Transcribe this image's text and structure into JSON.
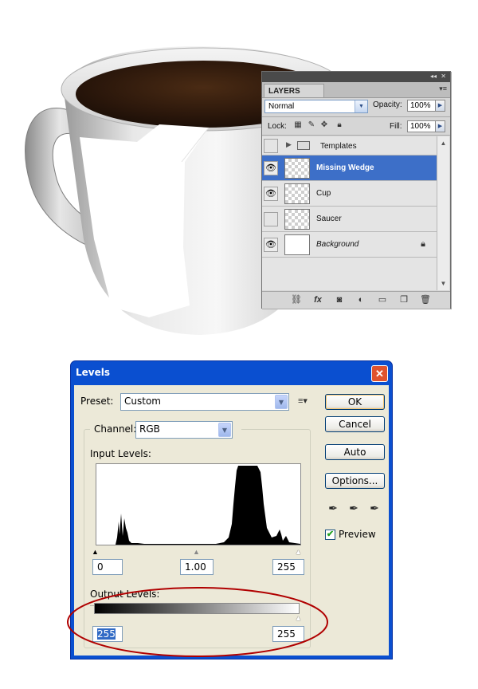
{
  "layers_panel": {
    "tab_label": "LAYERS",
    "collapse_glyph": "◂◂",
    "close_glyph": "✕",
    "menu_glyph": "▾≡",
    "blend_mode": "Normal",
    "opacity_label": "Opacity:",
    "opacity_value": "100%",
    "lock_label": "Lock:",
    "fill_label": "Fill:",
    "fill_value": "100%",
    "group_row": {
      "name": "Templates"
    },
    "layers": [
      {
        "name": "Missing Wedge",
        "visible": true,
        "selected": true
      },
      {
        "name": "Cup",
        "visible": true,
        "selected": false
      },
      {
        "name": "Saucer",
        "visible": false,
        "selected": false
      },
      {
        "name": "Background",
        "visible": true,
        "selected": false,
        "locked": true
      }
    ],
    "footer_icons": [
      "link-icon",
      "fx-icon",
      "mask-icon",
      "adjustment-icon",
      "group-folder-icon",
      "new-layer-icon",
      "trash-icon"
    ]
  },
  "levels_dialog": {
    "title": "Levels",
    "close_glyph": "✕",
    "preset_label": "Preset:",
    "preset_value": "Custom",
    "preset_menu_glyph": "≡▾",
    "channel_label": "Channel:",
    "channel_value": "RGB",
    "input_levels_label": "Input Levels:",
    "input_black": "0",
    "input_gamma": "1.00",
    "input_white": "255",
    "output_levels_label": "Output Levels:",
    "output_black": "255",
    "output_white": "255",
    "buttons": {
      "ok": "OK",
      "cancel": "Cancel",
      "auto": "Auto",
      "options": "Options..."
    },
    "preview_label": "Preview",
    "preview_checked": true,
    "annotation_color": "#b00000"
  }
}
